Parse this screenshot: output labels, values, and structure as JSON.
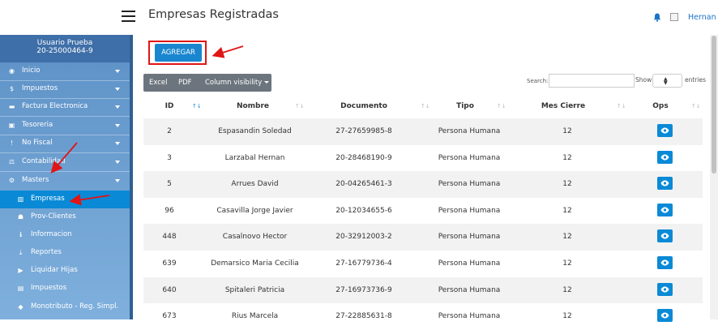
{
  "header": {
    "title": "Empresas Registradas",
    "user": "Hernan"
  },
  "sidebar": {
    "user_name": "Usuario Prueba",
    "user_id": "20-25000464-9",
    "items": [
      {
        "label": "Inicio",
        "icon": "dashboard-icon"
      },
      {
        "label": "Impuestos",
        "icon": "dollar-icon"
      },
      {
        "label": "Factura Electronica",
        "icon": "invoice-icon"
      },
      {
        "label": "Tesoreria",
        "icon": "money-icon"
      },
      {
        "label": "No Fiscal",
        "icon": "exclamation-icon"
      },
      {
        "label": "Contabilidad",
        "icon": "balance-icon"
      },
      {
        "label": "Masters",
        "icon": "cogs-icon"
      }
    ],
    "subitems": [
      {
        "label": "Empresas",
        "icon": "building-icon"
      },
      {
        "label": "Prov-Clientes",
        "icon": "users-icon"
      },
      {
        "label": "Informacion",
        "icon": "info-icon"
      },
      {
        "label": "Reportes",
        "icon": "download-icon"
      },
      {
        "label": "Liquidar Hijas",
        "icon": "play-icon"
      },
      {
        "label": "Impuestos",
        "icon": "file-icon"
      },
      {
        "label": "Monotributo - Reg. Simpl.",
        "icon": "tag-icon"
      }
    ]
  },
  "toolbar": {
    "add_label": "AGREGAR",
    "excel": "Excel",
    "pdf": "PDF",
    "colvis": "Column visibility"
  },
  "filters": {
    "search_label": "Search:",
    "show_label": "Show",
    "entries_label": "entries"
  },
  "table": {
    "columns": [
      "ID",
      "Nombre",
      "Documento",
      "Tipo",
      "Mes Cierre",
      "Ops"
    ],
    "rows": [
      [
        "2",
        "Espasandin Soledad",
        "27-27659985-8",
        "Persona Humana",
        "12"
      ],
      [
        "3",
        "Larzabal Hernan",
        "20-28468190-9",
        "Persona Humana",
        "12"
      ],
      [
        "5",
        "Arrues David",
        "20-04265461-3",
        "Persona Humana",
        "12"
      ],
      [
        "96",
        "Casavilla Jorge Javier",
        "20-12034655-6",
        "Persona Humana",
        "12"
      ],
      [
        "448",
        "Casalnovo Hector",
        "20-32912003-2",
        "Persona Humana",
        "12"
      ],
      [
        "639",
        "Demarsico Maria Cecilia",
        "27-16779736-4",
        "Persona Humana",
        "12"
      ],
      [
        "640",
        "Spitaleri Patricia",
        "27-16973736-9",
        "Persona Humana",
        "12"
      ],
      [
        "673",
        "Rius Marcela",
        "27-22885631-8",
        "Persona Humana",
        "12"
      ]
    ]
  },
  "colors": {
    "accent": "#0a8ad6",
    "sidebar_top": "#5d91c6",
    "annotation": "#e01515"
  }
}
